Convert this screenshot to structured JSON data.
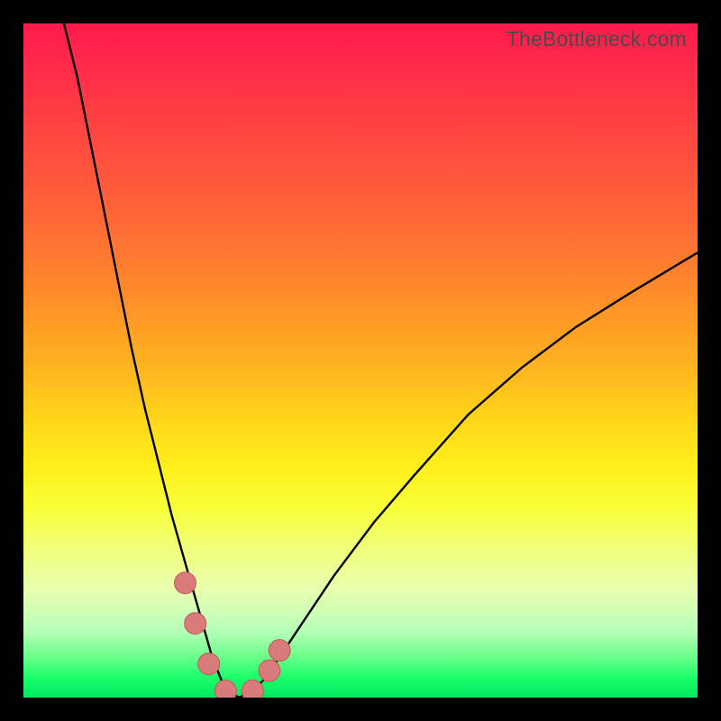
{
  "watermark": "TheBottleneck.com",
  "colors": {
    "frame": "#000000",
    "curve": "#000000",
    "marker_fill": "#d97b7b",
    "marker_stroke": "#bf5a5a"
  },
  "chart_data": {
    "type": "line",
    "title": "",
    "xlabel": "",
    "ylabel": "",
    "xlim": [
      0,
      100
    ],
    "ylim": [
      0,
      100
    ],
    "grid": false,
    "legend": false,
    "description": "Bottleneck-style V-shaped performance curve. Y axis is qualitative fit (green=good near bottom, red=bad near top). X is an unlabeled parameter; curve dips to ~0 around x≈29–35 then rises again.",
    "series": [
      {
        "name": "curve",
        "x": [
          6,
          8,
          10,
          12,
          14,
          16,
          18,
          20,
          22,
          24,
          26,
          28,
          30,
          32,
          34,
          36,
          38,
          42,
          46,
          52,
          58,
          66,
          74,
          82,
          90,
          100
        ],
        "y": [
          100,
          92,
          82,
          72,
          62,
          52,
          43,
          35,
          27,
          20,
          13,
          6,
          1,
          0,
          1,
          3,
          6,
          12,
          18,
          26,
          33,
          42,
          49,
          55,
          60,
          66
        ]
      }
    ],
    "markers": [
      {
        "x": 24.0,
        "y": 17.0
      },
      {
        "x": 25.5,
        "y": 11.0
      },
      {
        "x": 27.5,
        "y": 5.0
      },
      {
        "x": 30.0,
        "y": 1.0
      },
      {
        "x": 34.0,
        "y": 1.0
      },
      {
        "x": 36.5,
        "y": 4.0
      },
      {
        "x": 38.0,
        "y": 7.0
      }
    ],
    "marker_radius_px": 12
  }
}
